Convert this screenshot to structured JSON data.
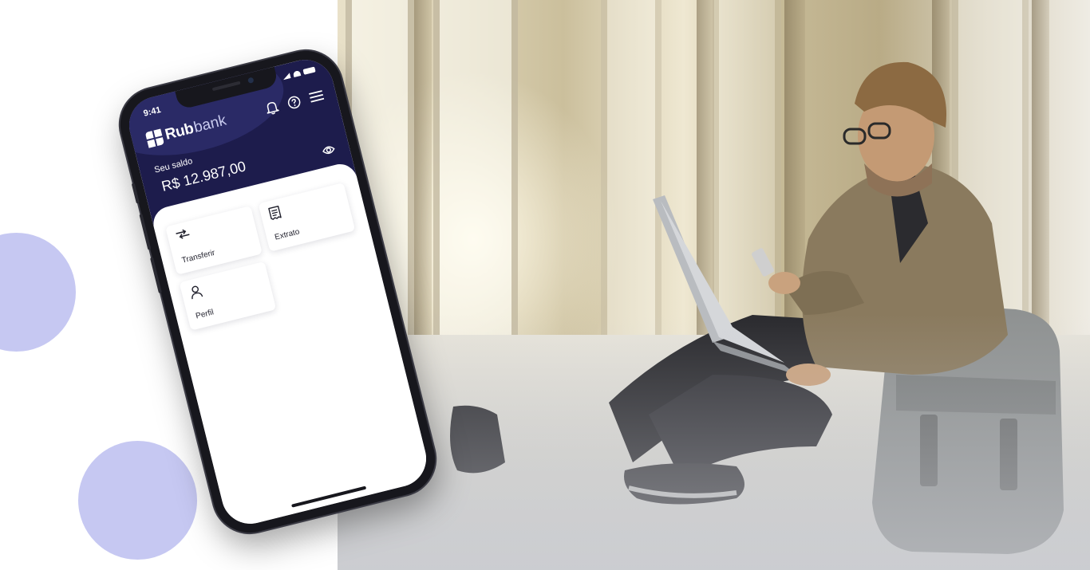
{
  "status_bar": {
    "time": "9:41"
  },
  "brand": {
    "name_bold": "Rub",
    "name_light": "bank"
  },
  "balance": {
    "label": "Seu saldo",
    "value": "R$ 12.987,00"
  },
  "header_icons": [
    "bell-icon",
    "help-icon",
    "menu-icon"
  ],
  "actions": [
    {
      "label": "Transferir",
      "icon": "transfer-arrows-icon"
    },
    {
      "label": "Extrato",
      "icon": "receipt-icon"
    },
    {
      "label": "Perfil",
      "icon": "user-icon"
    }
  ],
  "colors": {
    "header_bg": "#1d1c4c",
    "accent_circle": "#c6c8f2",
    "card_bg": "#ffffff"
  }
}
